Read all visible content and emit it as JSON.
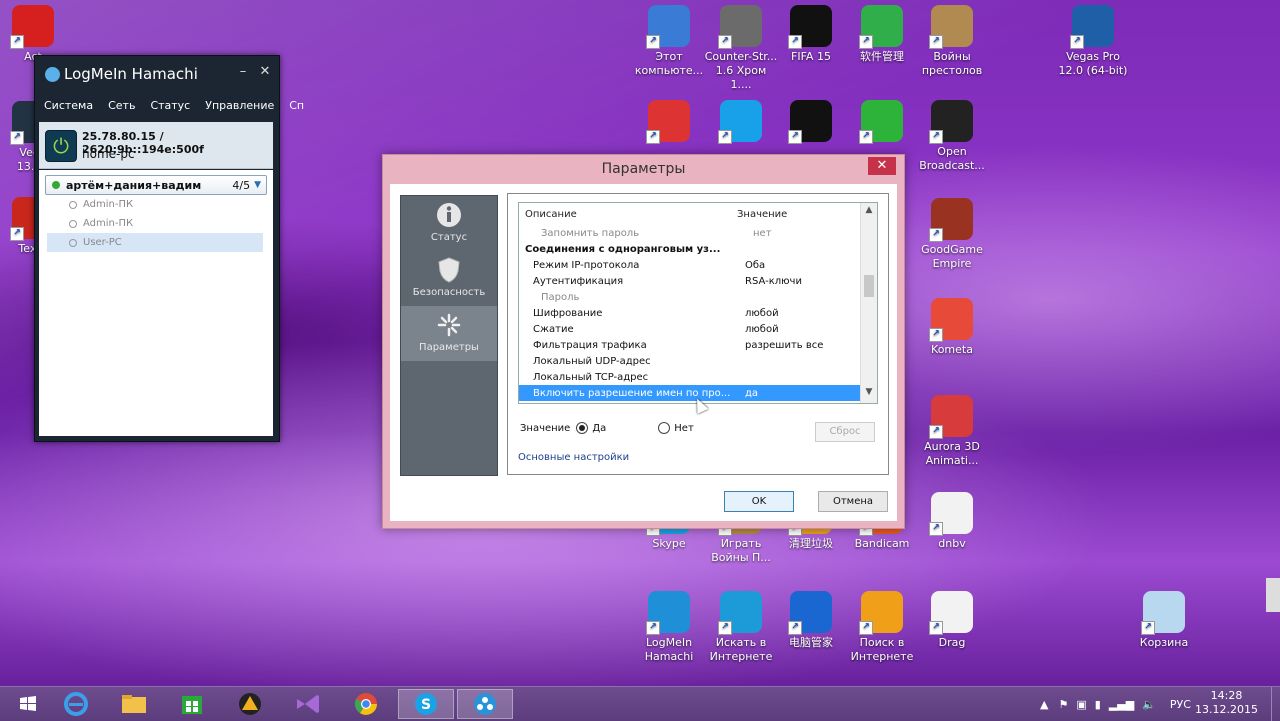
{
  "desktop_icons": [
    {
      "label": "Act",
      "color": "#d62020"
    },
    {
      "label": "Vega\n13.0 (",
      "color": "#223344"
    },
    {
      "label": "TextE",
      "color": "#c9261c"
    },
    {
      "label": "Этот\nкомпьюте...",
      "color": "#3a7bd5"
    },
    {
      "label": "Counter-Str...\n1.6 Хром 1....",
      "color": "#6b6b6b"
    },
    {
      "label": "FIFA 15",
      "color": "#111111"
    },
    {
      "label": "软件管理",
      "color": "#2fae4a"
    },
    {
      "label": "Войны\nпрестолов",
      "color": "#b08a50"
    },
    {
      "label": "Vegas Pro\n12.0 (64-bit)",
      "color": "#1f5fa8"
    },
    {
      "label": "",
      "color": "#dd3333"
    },
    {
      "label": "",
      "color": "#18a0e8"
    },
    {
      "label": "",
      "color": "#111111"
    },
    {
      "label": "",
      "color": "#2db33a"
    },
    {
      "label": "Open\nBroadcast...",
      "color": "#222222"
    },
    {
      "label": "GoodGame\nEmpire",
      "color": "#9a3222"
    },
    {
      "label": "Kometa",
      "color": "#e84a3a"
    },
    {
      "label": "Aurora 3D\nAnimati...",
      "color": "#d83b3b"
    },
    {
      "label": "dnbv",
      "color": "#f2f2f2"
    },
    {
      "label": "Skype",
      "color": "#19a3e6"
    },
    {
      "label": "Играть\nВойны П...",
      "color": "#b38a43"
    },
    {
      "label": "清理垃圾",
      "color": "#e8a020"
    },
    {
      "label": "Bandicam",
      "color": "#e85a20"
    },
    {
      "label": "LogMeIn\nHamachi",
      "color": "#1f8fd8"
    },
    {
      "label": "Искать в\nИнтернете",
      "color": "#1d9bd8"
    },
    {
      "label": "电脑管家",
      "color": "#1a67d2"
    },
    {
      "label": "Поиск в\nИнтернете",
      "color": "#f0a018"
    },
    {
      "label": "Drag",
      "color": "#f2f2f2"
    },
    {
      "label": "Корзина",
      "color": "#b8d8f0"
    }
  ],
  "hamachi": {
    "title": "LogMeIn Hamachi",
    "menu": [
      "Система",
      "Сеть",
      "Статус",
      "Управление",
      "Сп"
    ],
    "ip": "25.78.80.15 / 2620:9b::194e:500f",
    "hostname": "home-pc",
    "network": {
      "name": "артём+дания+вадим",
      "count": "4/5"
    },
    "peers": [
      "Admin-ПК",
      "Admin-ПК",
      "User-PC"
    ]
  },
  "dialog": {
    "title": "Параметры",
    "sidebar": [
      "Статус",
      "Безопасность",
      "Параметры"
    ],
    "columns": {
      "desc": "Описание",
      "value": "Значение"
    },
    "rows": [
      {
        "desc": "Запомнить пароль",
        "value": "нет",
        "style": "grey",
        "indent": 2
      },
      {
        "desc": "Соединения с одноранговым уз...",
        "value": "",
        "style": "bold",
        "indent": 0
      },
      {
        "desc": "Режим IP-протокола",
        "value": "Оба",
        "style": "",
        "indent": 1
      },
      {
        "desc": "Аутентификация",
        "value": "RSA-ключи",
        "style": "",
        "indent": 1
      },
      {
        "desc": "Пароль",
        "value": "",
        "style": "grey",
        "indent": 2
      },
      {
        "desc": "Шифрование",
        "value": "любой",
        "style": "",
        "indent": 1
      },
      {
        "desc": "Сжатие",
        "value": "любой",
        "style": "",
        "indent": 1
      },
      {
        "desc": "Фильтрация трафика",
        "value": "разрешить все",
        "style": "",
        "indent": 1
      },
      {
        "desc": "Локальный UDP-адрес",
        "value": "",
        "style": "",
        "indent": 1
      },
      {
        "desc": "Локальный TCP-адрес",
        "value": "",
        "style": "",
        "indent": 1
      },
      {
        "desc": "Включить разрешение имен по про...",
        "value": "да",
        "style": "sel",
        "indent": 1
      }
    ],
    "value_label": "Значение",
    "radio_yes": "Да",
    "radio_no": "Нет",
    "reset": "Сброс",
    "basic_link": "Основные настройки",
    "ok": "OK",
    "cancel": "Отмена"
  },
  "taskbar": {
    "lang": "РУС",
    "time": "14:28",
    "date": "13.12.2015"
  }
}
